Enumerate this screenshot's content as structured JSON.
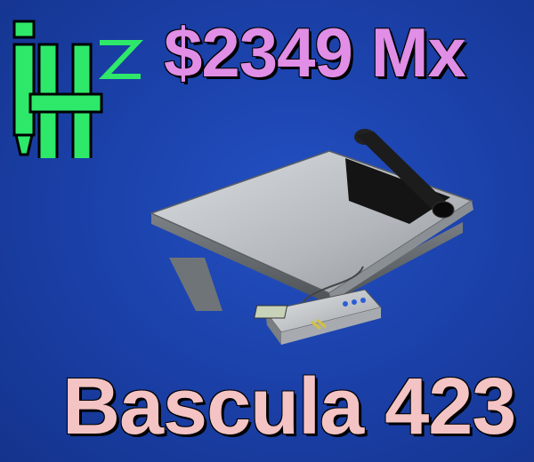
{
  "logo": {
    "main": "H",
    "superscript": "Z",
    "icon": "hz-brand-logo",
    "color": "#2ee86a"
  },
  "price": {
    "text": "$2349 Mx",
    "color": "#e08ee6"
  },
  "product": {
    "name": "Bascula 423",
    "image": "platform-scale-with-display",
    "name_color": "#f4c3c3"
  },
  "colors": {
    "background": "#1a3fa6"
  }
}
